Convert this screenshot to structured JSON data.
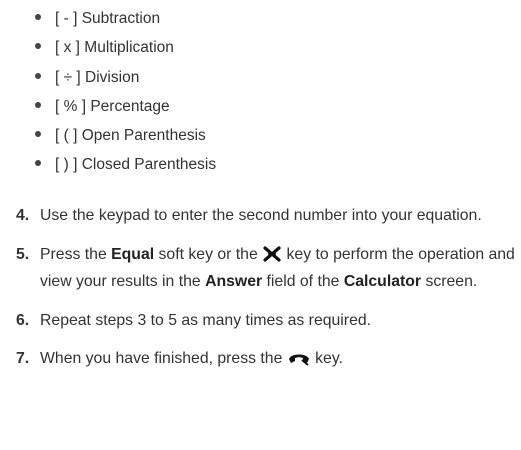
{
  "operators": [
    {
      "symbol": "[ - ]",
      "label": "Subtraction"
    },
    {
      "symbol": "[ x ]",
      "label": "Multiplication"
    },
    {
      "symbol": "[ ÷ ]",
      "label": "Division"
    },
    {
      "symbol": "[ % ]",
      "label": "Percentage"
    },
    {
      "symbol": "[ ( ]",
      "label": "Open Parenthesis"
    },
    {
      "symbol": "[ ) ]",
      "label": "Closed Parenthesis"
    }
  ],
  "steps": {
    "s4": {
      "number": "4.",
      "text": "Use the keypad to enter the second number into your equation."
    },
    "s5": {
      "number": "5.",
      "t1": "Press the ",
      "b1": "Equal",
      "t2": " soft key or the ",
      "icon": "x-key-icon",
      "t3": " key to perform the operation and view your results in the ",
      "b2": "Answer",
      "t4": " field of the ",
      "b3": "Calculator",
      "t5": " screen."
    },
    "s6": {
      "number": "6.",
      "text": "Repeat steps 3 to 5 as many times as required."
    },
    "s7": {
      "number": "7.",
      "t1": "When you have finished, press the ",
      "icon": "end-call-key-icon",
      "t2": " key."
    }
  }
}
